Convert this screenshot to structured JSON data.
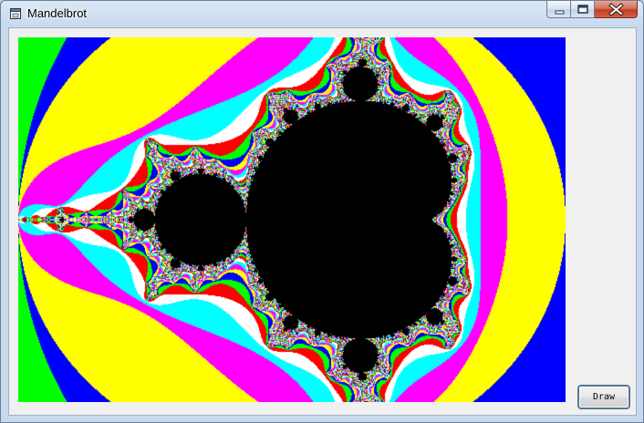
{
  "window": {
    "title": "Mandelbrot",
    "icon": "app-window-icon"
  },
  "caption_buttons": {
    "minimize_icon": "minimize-icon",
    "maximize_icon": "maximize-icon",
    "close_icon": "close-icon"
  },
  "toolbar": {
    "draw_label": "Draw"
  },
  "fractal": {
    "palette": [
      "#ff0000",
      "#00ff00",
      "#0000ff",
      "#ffff00",
      "#ff00ff",
      "#00ffff",
      "#ffffff"
    ],
    "set_color": "#000000",
    "view_x": [
      -2.0,
      1.0
    ],
    "view_y": [
      -1.0,
      1.0
    ]
  }
}
